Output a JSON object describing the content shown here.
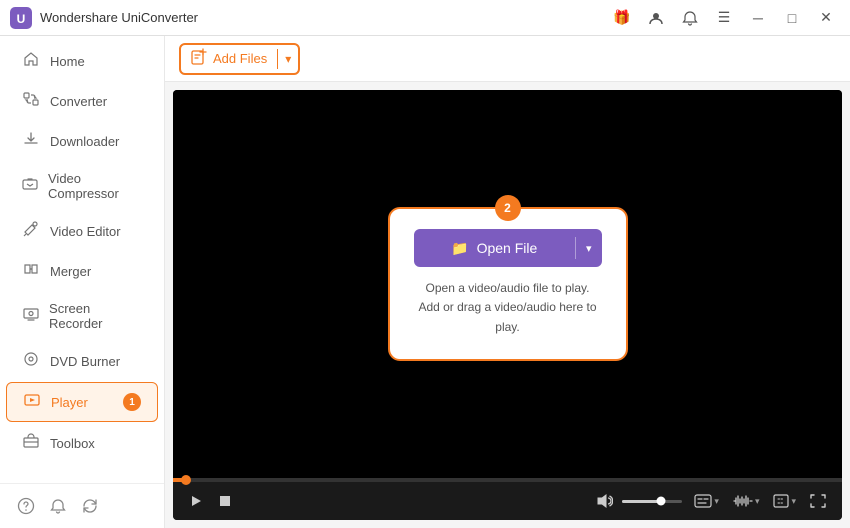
{
  "titlebar": {
    "title": "Wondershare UniConverter",
    "controls": [
      "gift-icon",
      "user-icon",
      "notification-icon",
      "menu-icon",
      "minimize-icon",
      "maximize-icon",
      "close-icon"
    ]
  },
  "sidebar": {
    "items": [
      {
        "id": "home",
        "label": "Home",
        "icon": "🏠",
        "active": false
      },
      {
        "id": "converter",
        "label": "Converter",
        "icon": "⬡",
        "active": false
      },
      {
        "id": "downloader",
        "label": "Downloader",
        "icon": "⬇",
        "active": false
      },
      {
        "id": "video-compressor",
        "label": "Video Compressor",
        "icon": "🗜",
        "active": false
      },
      {
        "id": "video-editor",
        "label": "Video Editor",
        "icon": "✂",
        "active": false
      },
      {
        "id": "merger",
        "label": "Merger",
        "icon": "⊕",
        "active": false
      },
      {
        "id": "screen-recorder",
        "label": "Screen Recorder",
        "icon": "⬡",
        "active": false
      },
      {
        "id": "dvd-burner",
        "label": "DVD Burner",
        "icon": "💿",
        "active": false
      },
      {
        "id": "player",
        "label": "Player",
        "icon": "▶",
        "active": true,
        "badge": "1"
      },
      {
        "id": "toolbox",
        "label": "Toolbox",
        "icon": "⊞",
        "active": false
      }
    ],
    "bottom_icons": [
      "help-icon",
      "bell-icon",
      "refresh-icon"
    ]
  },
  "toolbar": {
    "add_button_label": "Add Files",
    "add_icon": "📄",
    "dropdown_icon": "▾"
  },
  "player": {
    "step_badge": "2",
    "open_file_label": "Open File",
    "open_file_icon": "📁",
    "hint_line1": "Open a video/audio file to play.",
    "hint_line2": "Add or drag a video/audio here to play.",
    "progress_value": 2,
    "volume_value": 65
  },
  "controls": {
    "play_icon": "▶",
    "stop_icon": "■",
    "volume_icon": "🔊",
    "caption_label": "TT",
    "waveform_label": "~~~",
    "ratio_label": "⊡",
    "fullscreen_label": "⛶"
  }
}
